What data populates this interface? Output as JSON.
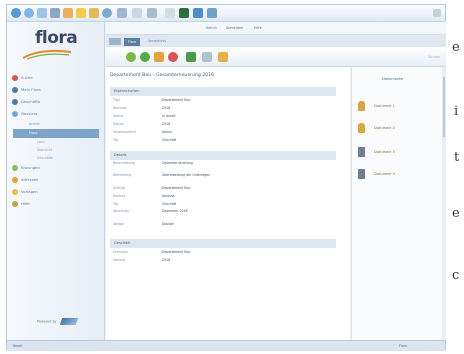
{
  "page_letters": [
    "e",
    "i",
    "t",
    "e",
    "c"
  ],
  "app": {
    "logo": "flora",
    "footer": "Powered by"
  },
  "user_bar": {
    "user": "Admin",
    "logout": "Abmelden",
    "help": "Hilfe"
  },
  "crumb": {
    "tab": "Flora",
    "text": "Verzeichnis"
  },
  "search_hint": "Suchen",
  "sidebar": {
    "items": [
      {
        "label": "Suche",
        "color": "#d9534f"
      },
      {
        "label": "Mein Flora",
        "color": "#4a7bb0"
      },
      {
        "label": "Geschäfte",
        "color": "#4a7bb0"
      },
      {
        "label": "Dossiers",
        "color": "#6fa8d8"
      },
      {
        "label": "Sitzungen",
        "color": "#8bbf5a"
      },
      {
        "label": "Adressen",
        "color": "#e0a13a"
      },
      {
        "label": "Vorlagen",
        "color": "#e0c04a"
      },
      {
        "label": "Hilfe",
        "color": "#c9a04a"
      }
    ],
    "subitems": [
      "Archiv",
      "Flora",
      "Liste",
      "Übersicht",
      "Geschäfte"
    ],
    "active_sub": "Flora"
  },
  "document": {
    "title": "Departement Bau – Gesamterneuerung 2016",
    "sections": [
      {
        "head": "Eigenschaften",
        "rows": [
          {
            "k": "Titel",
            "v": "Departement Bau"
          },
          {
            "k": "Nummer",
            "v": "2016"
          },
          {
            "k": "Status",
            "v": "In Arbeit"
          },
          {
            "k": "Datum",
            "v": "2016"
          },
          {
            "k": "Verantwortlich",
            "v": "Admin"
          },
          {
            "k": "Typ",
            "v": "Geschäft"
          }
        ]
      },
      {
        "head": "Details",
        "rows": [
          {
            "k": "Beschreibung",
            "v": "Gesamterneuerung"
          },
          {
            "k": "Bemerkung",
            "v": "Überarbeitung der Unterlagen"
          },
          {
            "k": "Auftrag",
            "v": "Departement Bau"
          },
          {
            "k": "Kontakt",
            "v": "Adresse"
          },
          {
            "k": "Typ",
            "v": "Geschäft"
          },
          {
            "k": "Abschluss",
            "v": "Dezember 2016"
          },
          {
            "k": "Ablage",
            "v": "Dossier"
          }
        ]
      },
      {
        "head": "Geschäft",
        "rows": [
          {
            "k": "Gremium",
            "v": "Departement Bau"
          },
          {
            "k": "Sitzung",
            "v": "2016"
          }
        ]
      }
    ]
  },
  "right_panel": {
    "title": "Dokumente",
    "items": [
      {
        "label": "Dokument 1",
        "color": "#d9a441"
      },
      {
        "label": "Dokument 2",
        "color": "#d9a441"
      },
      {
        "label": "Dokument 3",
        "color": "#6d7f90"
      },
      {
        "label": "Dokument 4",
        "color": "#6d7f90"
      }
    ]
  },
  "status_bar": {
    "left": "Bereit",
    "right": "Flora"
  }
}
